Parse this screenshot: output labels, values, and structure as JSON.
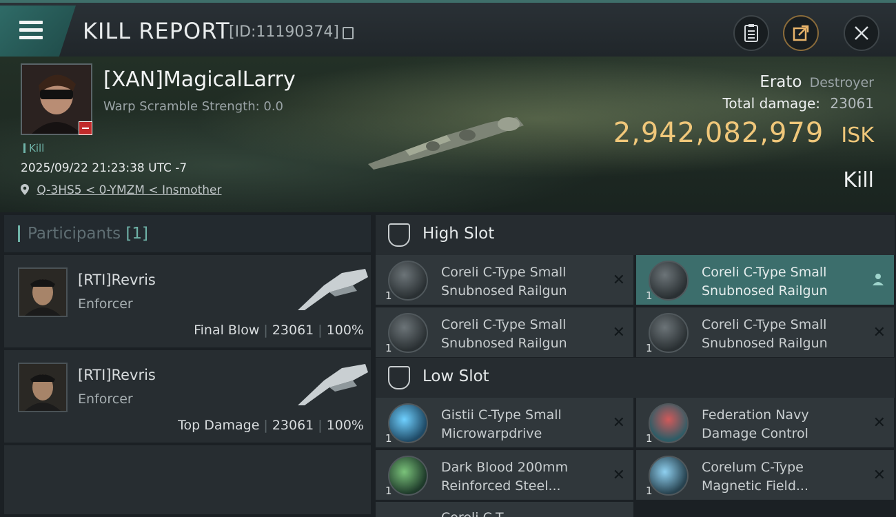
{
  "header": {
    "title": "KILL REPORT",
    "kill_id": "[ID:11190374]"
  },
  "victim": {
    "name": "[XAN]MagicalLarry",
    "warp_scramble": "Warp Scramble Strength: 0.0",
    "kill_tag": "Kill",
    "datetime": "2025/09/22 21:23:38 UTC -7",
    "location": "Q-3HS5 < 0-YMZM < Insmother",
    "ship_name": "Erato",
    "ship_class": "Destroyer",
    "total_damage_label": "Total damage:",
    "total_damage": "23061",
    "isk_value": "2,942,082,979",
    "isk_unit": "ISK",
    "result": "Kill"
  },
  "participants": {
    "label": "Participants",
    "count": "[1]",
    "items": [
      {
        "name": "[RTI]Revris",
        "ship": "Enforcer",
        "role": "Final Blow",
        "damage": "23061",
        "percent": "100%"
      },
      {
        "name": "[RTI]Revris",
        "ship": "Enforcer",
        "role": "Top Damage",
        "damage": "23061",
        "percent": "100%"
      }
    ]
  },
  "slots": {
    "high": {
      "label": "High Slot",
      "items": [
        {
          "name": "Coreli C-Type Small Snubnosed Railgun",
          "qty": "1"
        },
        {
          "name": "Coreli C-Type Small Snubnosed Railgun",
          "qty": "1"
        },
        {
          "name": "Coreli C-Type Small Snubnosed Railgun",
          "qty": "1"
        },
        {
          "name": "Coreli C-Type Small Snubnosed Railgun",
          "qty": "1"
        }
      ]
    },
    "low": {
      "label": "Low Slot",
      "items": [
        {
          "name": "Gistii C-Type Small Microwarpdrive",
          "qty": "1"
        },
        {
          "name": "Federation Navy Damage Control",
          "qty": "1"
        },
        {
          "name": "Dark Blood 200mm Reinforced Steel...",
          "qty": "1"
        },
        {
          "name": "Corelum C-Type Magnetic Field...",
          "qty": "1"
        }
      ]
    },
    "partial_item": "Coreli C-T..."
  },
  "colors": {
    "accent_teal": "#6fb3a8",
    "isk_gold": "#f0c77a",
    "selected_row": "#3c6e6c"
  }
}
